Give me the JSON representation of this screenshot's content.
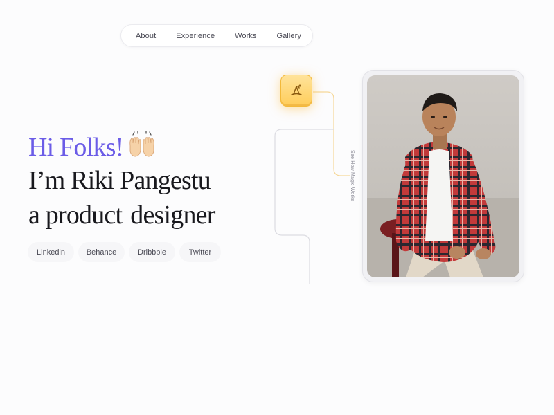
{
  "nav": {
    "items": [
      {
        "label": "About"
      },
      {
        "label": "Experience"
      },
      {
        "label": "Works"
      },
      {
        "label": "Gallery"
      }
    ]
  },
  "hero": {
    "greeting": "Hi Folks!",
    "wave_icon": "raising-hands-emoji",
    "line1": "I’m Riki Pangestu",
    "line2_a": "a product",
    "line2_b": "designer"
  },
  "socials": [
    {
      "label": "Linkedin"
    },
    {
      "label": "Behance"
    },
    {
      "label": "Dribbble"
    },
    {
      "label": "Twitter"
    }
  ],
  "magic": {
    "icon": "wizard-hat-icon",
    "label": "See How Magic Works"
  },
  "portrait": {
    "subject": "portrait-photo"
  },
  "colors": {
    "accent": "#6b5ce7",
    "magic_button": "#ffcd5a",
    "background": "#fcfcfd"
  }
}
